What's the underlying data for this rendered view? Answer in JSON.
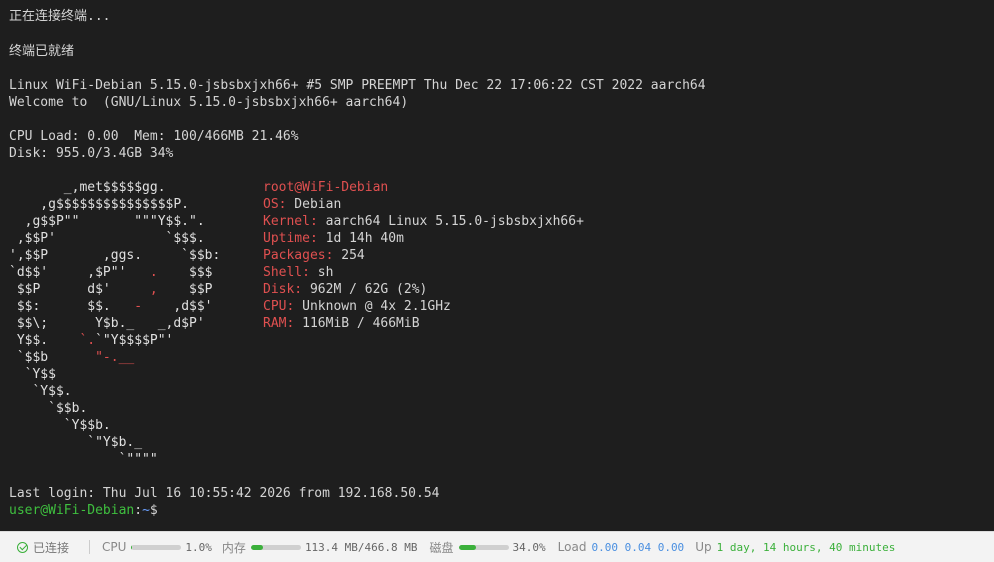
{
  "terminal": {
    "connecting": "正在连接终端...",
    "ready": "终端已就绪",
    "uname": "Linux WiFi-Debian 5.15.0-jsbsbxjxh66+ #5 SMP PREEMPT Thu Dec 22 17:06:22 CST 2022 aarch64",
    "welcome": "Welcome to  (GNU/Linux 5.15.0-jsbsbxjxh66+ aarch64)",
    "cpu_mem": "CPU Load: 0.00  Mem: 100/466MB 21.46%",
    "disk": "Disk: 955.0/3.4GB 34%",
    "logo": [
      {
        "a": "       _,met$$$$$gg.",
        "r": ""
      },
      {
        "a": "    ,g$$$$$$$$$$$$$$$P.",
        "r": ""
      },
      {
        "a": "  ,g$$P\"\"       \"\"\"Y$$.\".",
        "r": ""
      },
      {
        "a": " ,$$P'              `$$$.",
        "r": ""
      },
      {
        "a": "',$$P       ,ggs.     `$$b:",
        "r": ""
      },
      {
        "a": "`d$$'     ,$P\"'   ",
        "r": ".",
        "b": "    $$$"
      },
      {
        "a": " $$P      d$'     ",
        "r": ",",
        "b": "    $$P"
      },
      {
        "a": " $$:      $$.   ",
        "r": "-",
        "b": "    ,d$$'"
      },
      {
        "a": " $$\\;      Y$b._   _,d$P'",
        "r": ""
      },
      {
        "a": " Y$$.    ",
        "r": "`.",
        "b": "`\"Y$$$$P\"'"
      },
      {
        "a": " `$$b      ",
        "r": "\"-.__",
        "b": ""
      },
      {
        "a": "  `Y$$",
        "r": ""
      },
      {
        "a": "   `Y$$.",
        "r": ""
      },
      {
        "a": "     `$$b.",
        "r": ""
      },
      {
        "a": "       `Y$$b.",
        "r": ""
      },
      {
        "a": "          `\"Y$b._",
        "r": ""
      },
      {
        "a": "              `\"\"\"\"",
        "r": ""
      }
    ],
    "info_host": "root@WiFi-Debian",
    "info": [
      {
        "k": "OS:",
        "v": " Debian"
      },
      {
        "k": "Kernel:",
        "v": " aarch64 Linux 5.15.0-jsbsbxjxh66+"
      },
      {
        "k": "Uptime:",
        "v": " 1d 14h 40m"
      },
      {
        "k": "Packages:",
        "v": " 254"
      },
      {
        "k": "Shell:",
        "v": " sh"
      },
      {
        "k": "Disk:",
        "v": " 962M / 62G (2%)"
      },
      {
        "k": "CPU:",
        "v": " Unknown @ 4x 2.1GHz"
      },
      {
        "k": "RAM:",
        "v": " 116MiB / 466MiB"
      }
    ],
    "last_login": "Last login: Thu Jul 16 10:55:42 2026 from 192.168.50.54",
    "prompt_user": "user@WiFi-Debian",
    "prompt_colon": ":",
    "prompt_path": "~",
    "prompt_symbol": "$"
  },
  "status": {
    "connected": "已连接",
    "cpu_label": "CPU",
    "cpu_value": "1.0%",
    "cpu_fraction": 0.01,
    "mem_label": "内存",
    "mem_value": "113.4 MB/466.8 MB",
    "mem_fraction": 0.243,
    "disk_label": "磁盘",
    "disk_value": "34.0%",
    "disk_fraction": 0.34,
    "load_label": "Load",
    "load_values": "0.00 0.04 0.00",
    "up_label": "Up",
    "up_value": "1 day, 14 hours, 40 minutes",
    "accent_green": "#3bb03b",
    "accent_blue": "#4a8fe0"
  }
}
